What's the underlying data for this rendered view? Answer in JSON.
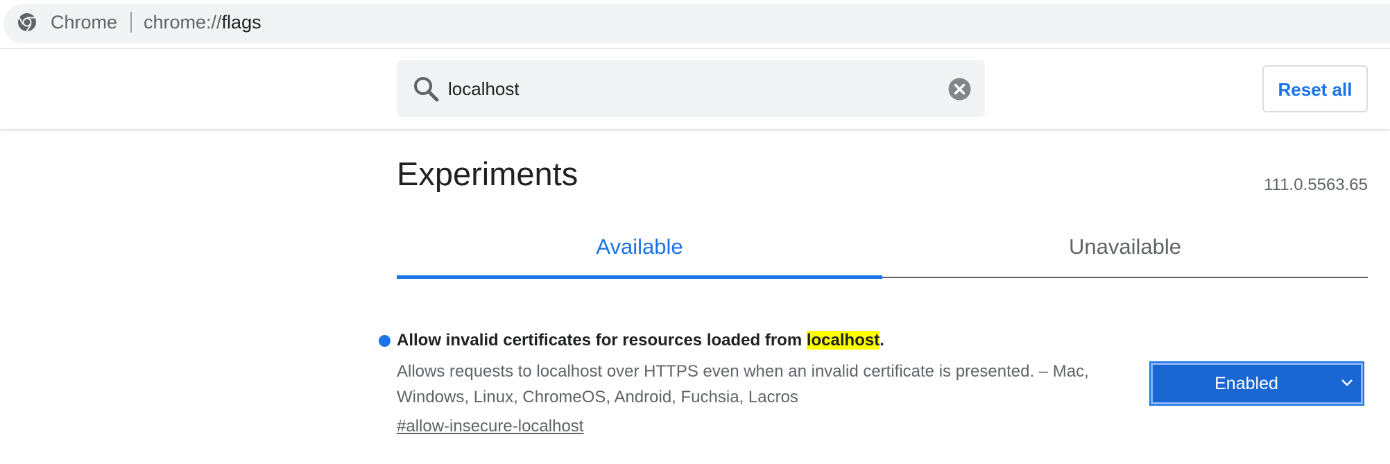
{
  "omnibox": {
    "app_name": "Chrome",
    "url_scheme": "chrome://",
    "url_path": "flags",
    "icon": "chrome-icon"
  },
  "search": {
    "value": "localhost",
    "icon": "search-icon",
    "clear_icon": "clear-icon"
  },
  "toolbar": {
    "reset_label": "Reset all"
  },
  "page": {
    "title": "Experiments",
    "version": "111.0.5563.65"
  },
  "tabs": [
    {
      "label": "Available",
      "active": true
    },
    {
      "label": "Unavailable",
      "active": false
    }
  ],
  "flags": [
    {
      "title_before": "Allow invalid certificates for resources loaded from ",
      "title_highlight": "localhost",
      "title_after": ".",
      "description": "Allows requests to localhost over HTTPS even when an invalid certificate is presented. – Mac, Windows, Linux, ChromeOS, Android, Fuchsia, Lacros",
      "link": "#allow-insecure-localhost",
      "state": "Enabled"
    }
  ],
  "colors": {
    "accent": "#1a73e8",
    "highlight": "#ffff00",
    "select_bg": "#1a66d2"
  }
}
